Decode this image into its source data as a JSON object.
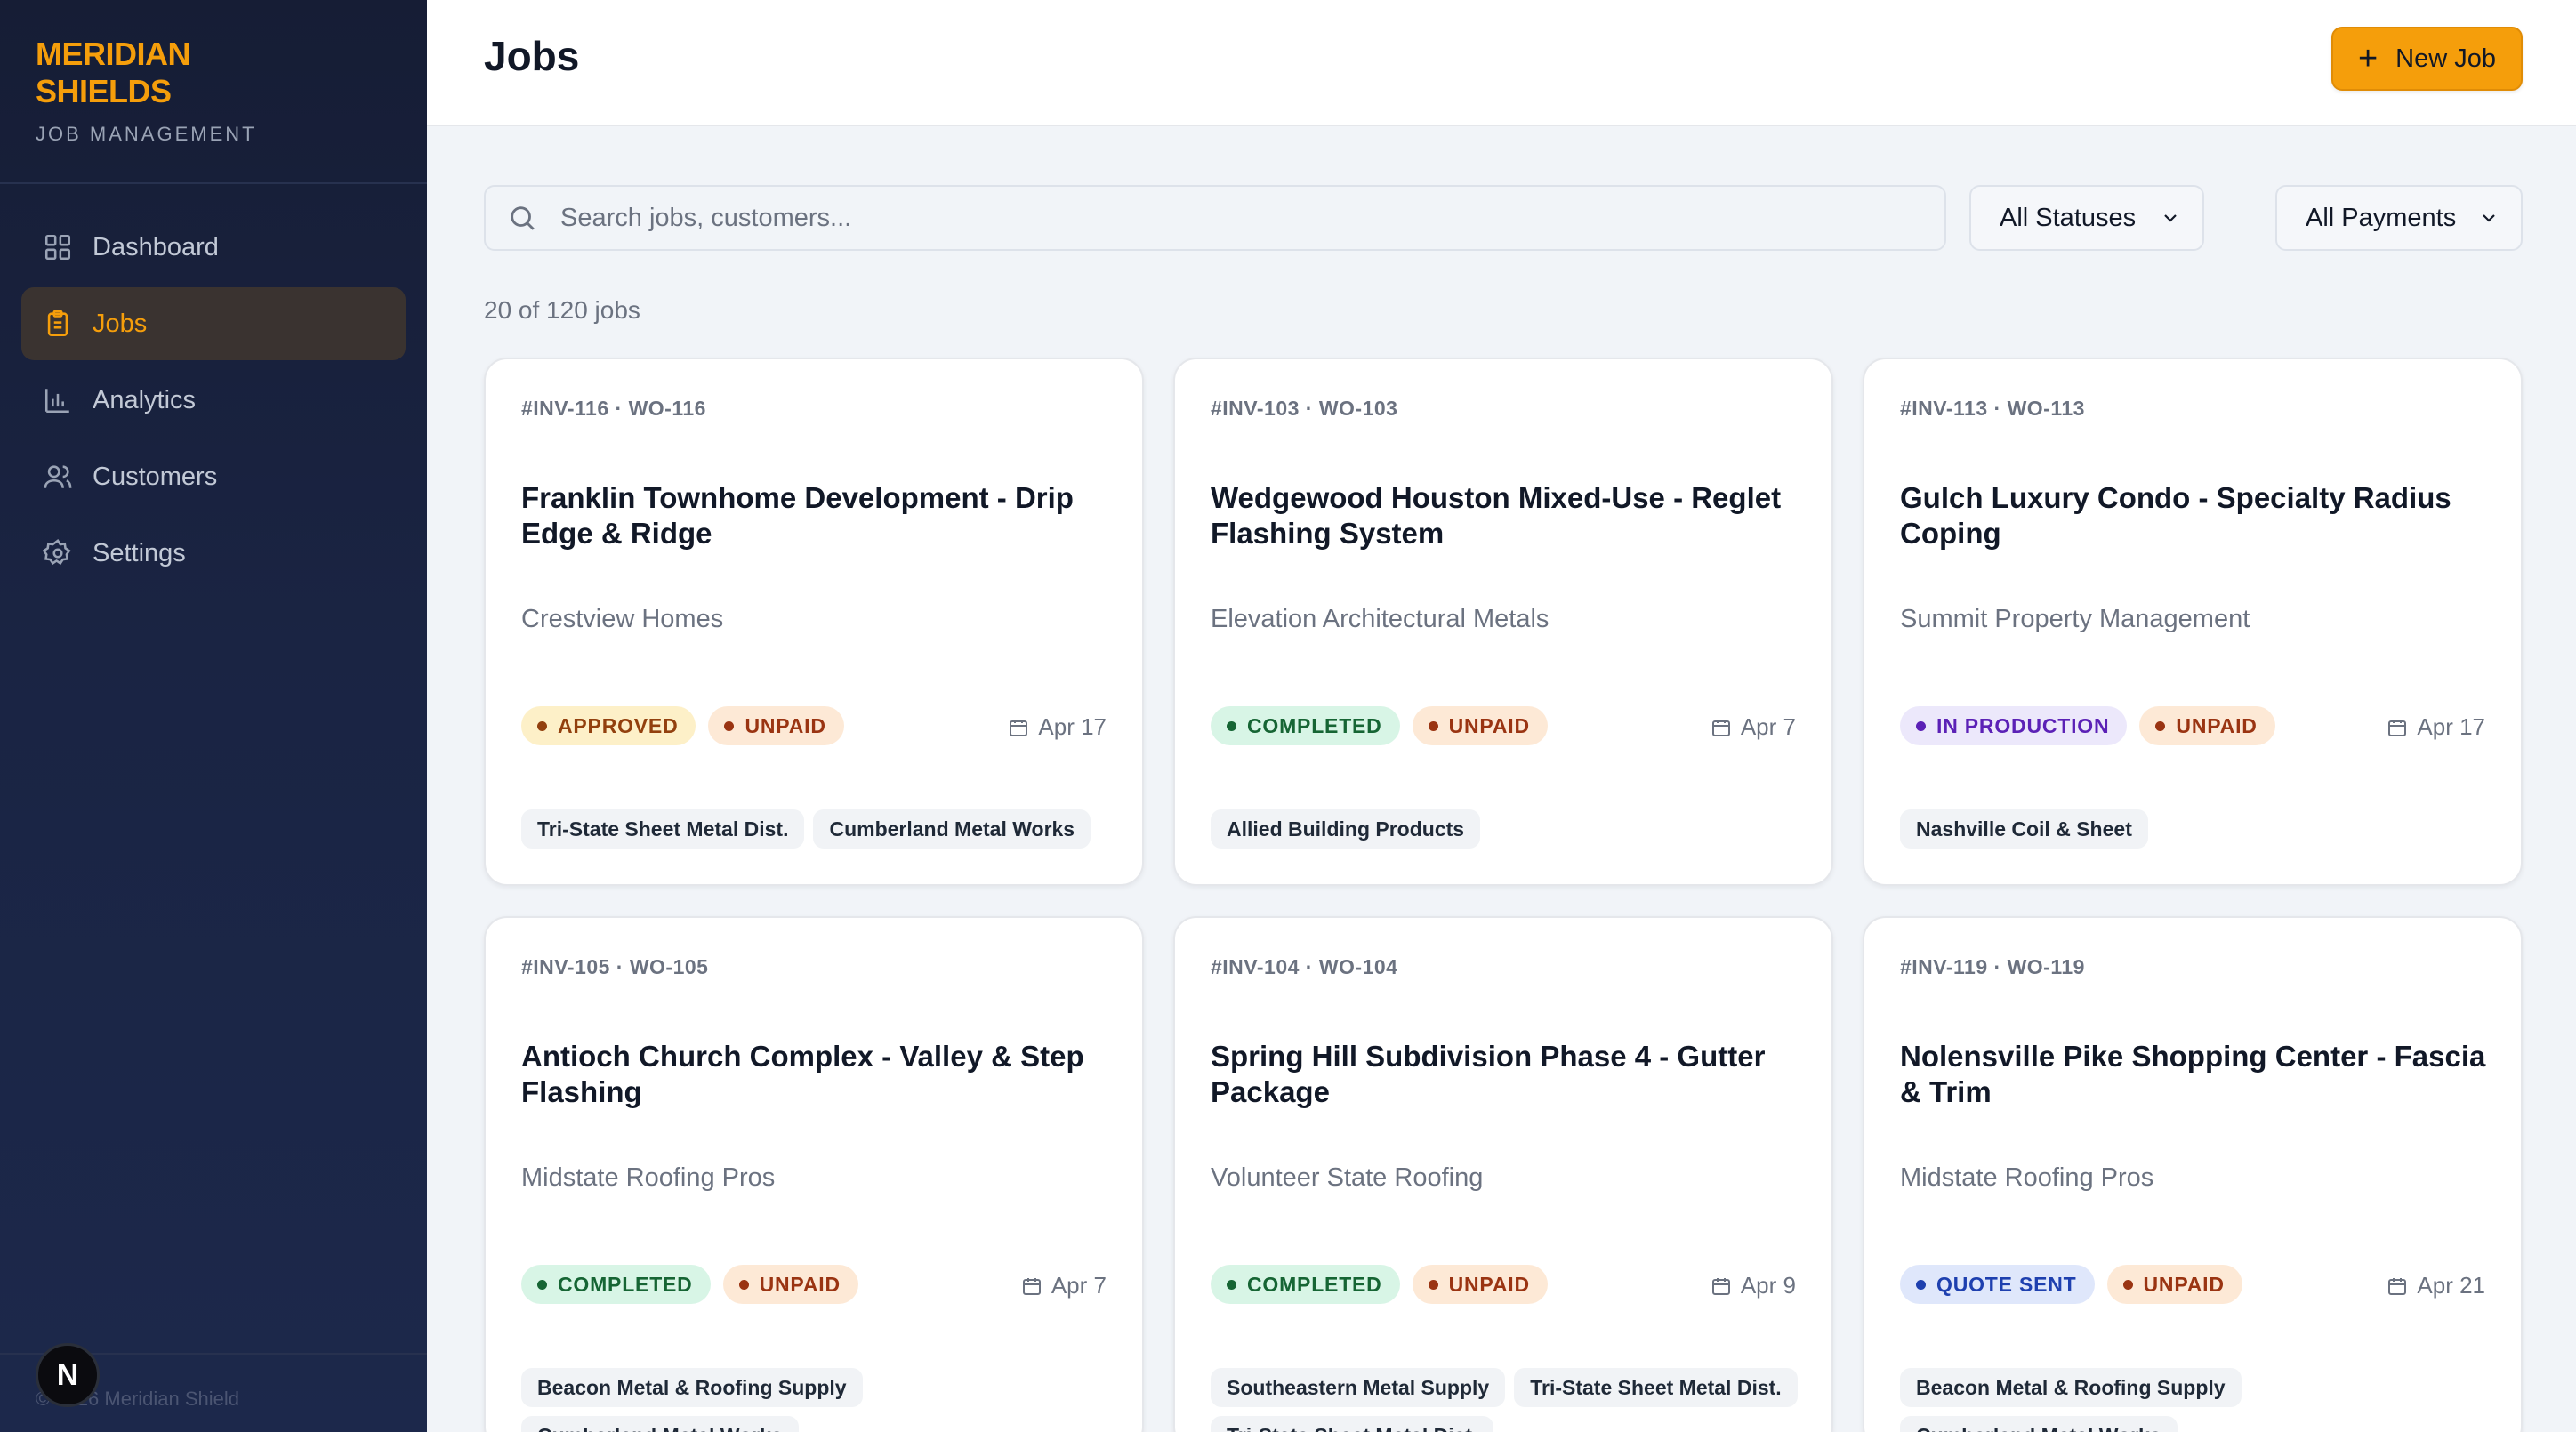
{
  "brand": {
    "title_line1": "MERIDIAN",
    "title_line2": "SHIELDS",
    "subtitle": "JOB MANAGEMENT"
  },
  "sidebar": {
    "items": [
      {
        "label": "Dashboard",
        "icon": "grid-icon",
        "active": false
      },
      {
        "label": "Jobs",
        "icon": "clipboard-icon",
        "active": true
      },
      {
        "label": "Analytics",
        "icon": "bar-chart-icon",
        "active": false
      },
      {
        "label": "Customers",
        "icon": "users-icon",
        "active": false
      },
      {
        "label": "Settings",
        "icon": "gear-icon",
        "active": false
      }
    ],
    "footer": "© 2026 Meridian Shield",
    "badge_letter": "N"
  },
  "header": {
    "title": "Jobs",
    "new_job_label": "New Job"
  },
  "filters": {
    "search_placeholder": "Search jobs, customers...",
    "status_value": "All Statuses",
    "payment_value": "All Payments",
    "count_text": "20 of 120 jobs"
  },
  "colors": {
    "accent": "#f59e0b",
    "approved_bg": "#fdf0c8",
    "approved_fg": "#92400e",
    "unpaid_bg": "#fde9d6",
    "unpaid_fg": "#9a3412",
    "completed_bg": "#d8f5e6",
    "completed_fg": "#166534",
    "production_bg": "#ece8fb",
    "production_fg": "#5b21b6",
    "quote_bg": "#dfe7fb",
    "quote_fg": "#1e40af"
  },
  "jobs": [
    {
      "ids": "#INV-116 · WO-116",
      "title": "Franklin Townhome Development - Drip Edge & Ridge",
      "customer": "Crestview Homes",
      "status": "APPROVED",
      "payment": "UNPAID",
      "date": "Apr 17",
      "suppliers": [
        "Tri-State Sheet Metal Dist.",
        "Cumberland Metal Works"
      ]
    },
    {
      "ids": "#INV-103 · WO-103",
      "title": "Wedgewood Houston Mixed-Use - Reglet Flashing System",
      "customer": "Elevation Architectural Metals",
      "status": "COMPLETED",
      "payment": "UNPAID",
      "date": "Apr 7",
      "suppliers": [
        "Allied Building Products"
      ]
    },
    {
      "ids": "#INV-113 · WO-113",
      "title": "Gulch Luxury Condo - Specialty Radius Coping",
      "customer": "Summit Property Management",
      "status": "IN PRODUCTION",
      "payment": "UNPAID",
      "date": "Apr 17",
      "suppliers": [
        "Nashville Coil & Sheet"
      ]
    },
    {
      "ids": "#INV-105 · WO-105",
      "title": "Antioch Church Complex - Valley & Step Flashing",
      "customer": "Midstate Roofing Pros",
      "status": "COMPLETED",
      "payment": "UNPAID",
      "date": "Apr 7",
      "suppliers": [
        "Beacon Metal & Roofing Supply",
        "Cumberland Metal Works"
      ]
    },
    {
      "ids": "#INV-104 · WO-104",
      "title": "Spring Hill Subdivision Phase 4 - Gutter Package",
      "customer": "Volunteer State Roofing",
      "status": "COMPLETED",
      "payment": "UNPAID",
      "date": "Apr 9",
      "suppliers": [
        "Southeastern Metal Supply",
        "Tri-State Sheet Metal Dist.",
        "Tri-State Sheet Metal Dist."
      ]
    },
    {
      "ids": "#INV-119 · WO-119",
      "title": "Nolensville Pike Shopping Center - Fascia & Trim",
      "customer": "Midstate Roofing Pros",
      "status": "QUOTE SENT",
      "payment": "UNPAID",
      "date": "Apr 21",
      "suppliers": [
        "Beacon Metal & Roofing Supply",
        "Cumberland Metal Works"
      ]
    }
  ]
}
